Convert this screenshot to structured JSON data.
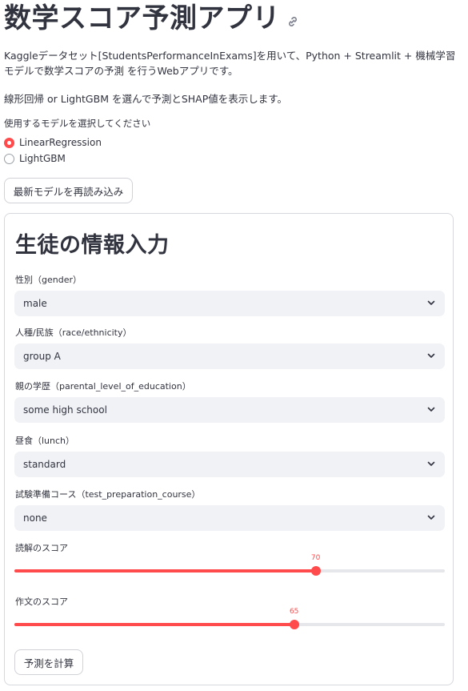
{
  "app": {
    "title": "数学スコア予測アプリ",
    "description": "Kaggleデータセット[StudentsPerformanceInExams]を用いて、Python + Streamlit + 機械学習モデルで数学スコアの予測 を行うWebアプリです。",
    "description2": "線形回帰 or LightGBM を選んで予測とSHAP値を表示します。"
  },
  "model_select": {
    "label": "使用するモデルを選択してください",
    "options": [
      "LinearRegression",
      "LightGBM"
    ],
    "selected": "LinearRegression"
  },
  "reload_button": "最新モデルを再読み込み",
  "form": {
    "title": "生徒の情報入力",
    "gender": {
      "label": "性別（gender）",
      "value": "male"
    },
    "race": {
      "label": "人種/民族（race/ethnicity）",
      "value": "group A"
    },
    "parent_edu": {
      "label": "親の学歴（parental_level_of_education）",
      "value": "some high school"
    },
    "lunch": {
      "label": "昼食（lunch）",
      "value": "standard"
    },
    "test_prep": {
      "label": "試験準備コース（test_preparation_course）",
      "value": "none"
    },
    "reading": {
      "label": "読解のスコア",
      "value": 70,
      "display": "70",
      "min": 0,
      "max": 100
    },
    "writing": {
      "label": "作文のスコア",
      "value": 65,
      "display": "65",
      "min": 0,
      "max": 100
    },
    "submit": "予測を計算"
  },
  "colors": {
    "accent": "#ff4b4b",
    "select_bg": "#f0f2f6",
    "text": "#31333f"
  },
  "icons": {
    "title_link": "link-icon",
    "select": "chevron-down-icon"
  }
}
